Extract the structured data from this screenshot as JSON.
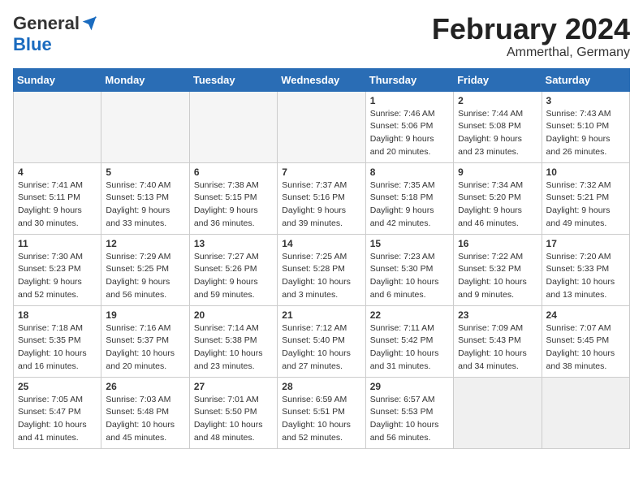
{
  "header": {
    "logo_general": "General",
    "logo_blue": "Blue",
    "month_title": "February 2024",
    "location": "Ammerthal, Germany"
  },
  "days_of_week": [
    "Sunday",
    "Monday",
    "Tuesday",
    "Wednesday",
    "Thursday",
    "Friday",
    "Saturday"
  ],
  "weeks": [
    [
      {
        "day": "",
        "empty": true
      },
      {
        "day": "",
        "empty": true
      },
      {
        "day": "",
        "empty": true
      },
      {
        "day": "",
        "empty": true
      },
      {
        "day": "1",
        "sunrise": "7:46 AM",
        "sunset": "5:06 PM",
        "daylight": "9 hours and 20 minutes."
      },
      {
        "day": "2",
        "sunrise": "7:44 AM",
        "sunset": "5:08 PM",
        "daylight": "9 hours and 23 minutes."
      },
      {
        "day": "3",
        "sunrise": "7:43 AM",
        "sunset": "5:10 PM",
        "daylight": "9 hours and 26 minutes."
      }
    ],
    [
      {
        "day": "4",
        "sunrise": "7:41 AM",
        "sunset": "5:11 PM",
        "daylight": "9 hours and 30 minutes."
      },
      {
        "day": "5",
        "sunrise": "7:40 AM",
        "sunset": "5:13 PM",
        "daylight": "9 hours and 33 minutes."
      },
      {
        "day": "6",
        "sunrise": "7:38 AM",
        "sunset": "5:15 PM",
        "daylight": "9 hours and 36 minutes."
      },
      {
        "day": "7",
        "sunrise": "7:37 AM",
        "sunset": "5:16 PM",
        "daylight": "9 hours and 39 minutes."
      },
      {
        "day": "8",
        "sunrise": "7:35 AM",
        "sunset": "5:18 PM",
        "daylight": "9 hours and 42 minutes."
      },
      {
        "day": "9",
        "sunrise": "7:34 AM",
        "sunset": "5:20 PM",
        "daylight": "9 hours and 46 minutes."
      },
      {
        "day": "10",
        "sunrise": "7:32 AM",
        "sunset": "5:21 PM",
        "daylight": "9 hours and 49 minutes."
      }
    ],
    [
      {
        "day": "11",
        "sunrise": "7:30 AM",
        "sunset": "5:23 PM",
        "daylight": "9 hours and 52 minutes."
      },
      {
        "day": "12",
        "sunrise": "7:29 AM",
        "sunset": "5:25 PM",
        "daylight": "9 hours and 56 minutes."
      },
      {
        "day": "13",
        "sunrise": "7:27 AM",
        "sunset": "5:26 PM",
        "daylight": "9 hours and 59 minutes."
      },
      {
        "day": "14",
        "sunrise": "7:25 AM",
        "sunset": "5:28 PM",
        "daylight": "10 hours and 3 minutes."
      },
      {
        "day": "15",
        "sunrise": "7:23 AM",
        "sunset": "5:30 PM",
        "daylight": "10 hours and 6 minutes."
      },
      {
        "day": "16",
        "sunrise": "7:22 AM",
        "sunset": "5:32 PM",
        "daylight": "10 hours and 9 minutes."
      },
      {
        "day": "17",
        "sunrise": "7:20 AM",
        "sunset": "5:33 PM",
        "daylight": "10 hours and 13 minutes."
      }
    ],
    [
      {
        "day": "18",
        "sunrise": "7:18 AM",
        "sunset": "5:35 PM",
        "daylight": "10 hours and 16 minutes."
      },
      {
        "day": "19",
        "sunrise": "7:16 AM",
        "sunset": "5:37 PM",
        "daylight": "10 hours and 20 minutes."
      },
      {
        "day": "20",
        "sunrise": "7:14 AM",
        "sunset": "5:38 PM",
        "daylight": "10 hours and 23 minutes."
      },
      {
        "day": "21",
        "sunrise": "7:12 AM",
        "sunset": "5:40 PM",
        "daylight": "10 hours and 27 minutes."
      },
      {
        "day": "22",
        "sunrise": "7:11 AM",
        "sunset": "5:42 PM",
        "daylight": "10 hours and 31 minutes."
      },
      {
        "day": "23",
        "sunrise": "7:09 AM",
        "sunset": "5:43 PM",
        "daylight": "10 hours and 34 minutes."
      },
      {
        "day": "24",
        "sunrise": "7:07 AM",
        "sunset": "5:45 PM",
        "daylight": "10 hours and 38 minutes."
      }
    ],
    [
      {
        "day": "25",
        "sunrise": "7:05 AM",
        "sunset": "5:47 PM",
        "daylight": "10 hours and 41 minutes."
      },
      {
        "day": "26",
        "sunrise": "7:03 AM",
        "sunset": "5:48 PM",
        "daylight": "10 hours and 45 minutes."
      },
      {
        "day": "27",
        "sunrise": "7:01 AM",
        "sunset": "5:50 PM",
        "daylight": "10 hours and 48 minutes."
      },
      {
        "day": "28",
        "sunrise": "6:59 AM",
        "sunset": "5:51 PM",
        "daylight": "10 hours and 52 minutes."
      },
      {
        "day": "29",
        "sunrise": "6:57 AM",
        "sunset": "5:53 PM",
        "daylight": "10 hours and 56 minutes."
      },
      {
        "day": "",
        "empty": true,
        "shaded": true
      },
      {
        "day": "",
        "empty": true,
        "shaded": true
      }
    ]
  ]
}
